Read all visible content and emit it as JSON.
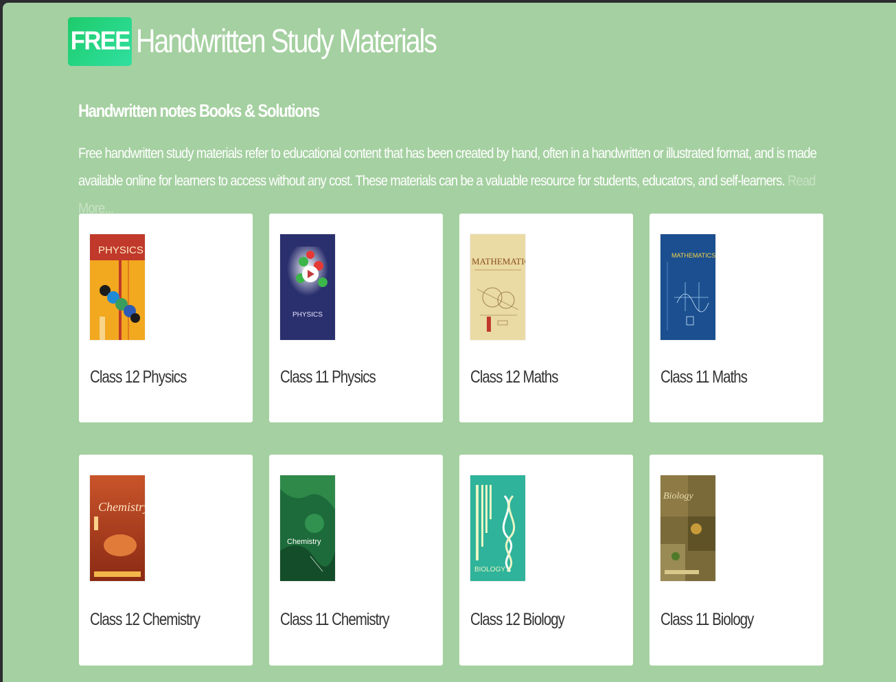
{
  "header": {
    "badge": "FREE",
    "title": "Handwritten Study Materials"
  },
  "section": {
    "subtitle": "Handwritten notes Books & Solutions",
    "description": "Free handwritten study materials refer to educational content that has been created by hand, often in a handwritten or illustrated format, and is made available online for learners to access without any cost. These materials can be a valuable resource for students, educators, and self-learners.",
    "read_more": "Read More..."
  },
  "cards": [
    {
      "label": "Class 12 Physics",
      "cover_text": "PHYSICS",
      "cover_color": "#f0a020"
    },
    {
      "label": "Class 11 Physics",
      "cover_text": "PHYSICS",
      "cover_color": "#2a2f6e"
    },
    {
      "label": "Class 12 Maths",
      "cover_text": "MATHEMATICS",
      "cover_color": "#e9d49a"
    },
    {
      "label": "Class 11 Maths",
      "cover_text": "MATHEMATICS",
      "cover_color": "#1a4f8f"
    },
    {
      "label": "Class 12 Chemistry",
      "cover_text": "Chemistry",
      "cover_color": "#c9542a"
    },
    {
      "label": "Class 11 Chemistry",
      "cover_text": "Chemistry",
      "cover_color": "#1d6b3a"
    },
    {
      "label": "Class 12 Biology",
      "cover_text": "Biology",
      "cover_color": "#2fb39a"
    },
    {
      "label": "Class 11 Biology",
      "cover_text": "Biology",
      "cover_color": "#7a6a3a"
    }
  ],
  "colors": {
    "page_background": "#a5d0a1",
    "badge_gradient_start": "#1ecb6a",
    "badge_gradient_end": "#2fe0a0",
    "card_background": "#ffffff",
    "card_text": "#333333",
    "read_more": "#c7e2c4"
  }
}
